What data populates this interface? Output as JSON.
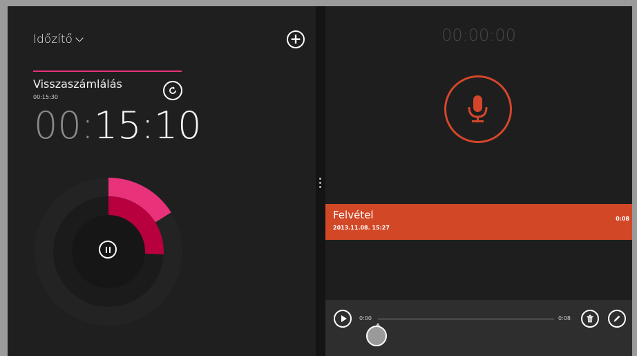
{
  "timer_panel": {
    "title": "Időzítő",
    "card": {
      "name": "Visszaszámlálás",
      "set_duration": "00:15:30",
      "remaining_hours": "00:",
      "remaining_rest": "15:10",
      "progress_fraction": 0.027
    },
    "icons": {
      "dropdown": "chevron-down-icon",
      "add": "plus-circle-icon",
      "reset": "refresh-icon",
      "pause": "pause-icon"
    },
    "colors": {
      "accent": "#e8327a",
      "accent_dark": "#b8003f"
    }
  },
  "recorder_panel": {
    "elapsed": "00:00:00",
    "recording": {
      "name": "Felvétel",
      "date": "2013.11.08. 15:27",
      "duration": "0:08"
    },
    "player": {
      "position": "0:00",
      "length": "0:08",
      "progress_fraction": 0
    },
    "icons": {
      "record": "microphone-icon",
      "play": "play-icon",
      "delete": "trash-icon",
      "rename": "pencil-icon"
    },
    "colors": {
      "accent": "#d24726"
    }
  }
}
